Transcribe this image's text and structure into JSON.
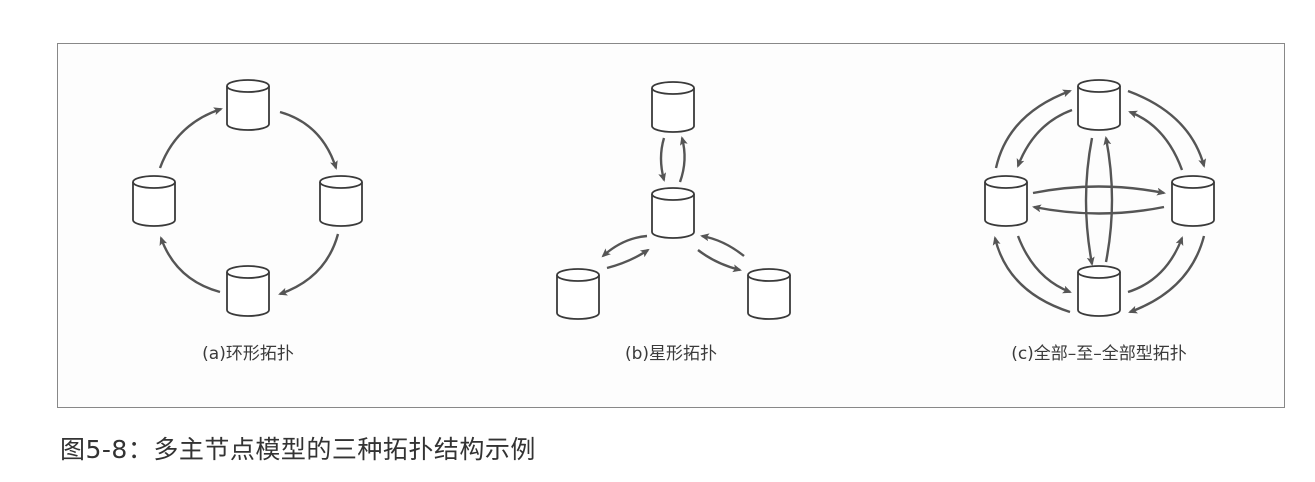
{
  "figure": {
    "caption": "图5-8：多主节点模型的三种拓扑结构示例"
  },
  "panels": [
    {
      "id": "ring",
      "caption": "(a)环形拓扑"
    },
    {
      "id": "star",
      "caption": "(b)星形拓扑"
    },
    {
      "id": "all-to-all",
      "caption": "(c)全部–至–全部型拓扑"
    }
  ],
  "node_icon": "database-cylinder-icon",
  "colors": {
    "stroke": "#3a3a3a",
    "arrow": "#555555",
    "frame": "#888888"
  }
}
